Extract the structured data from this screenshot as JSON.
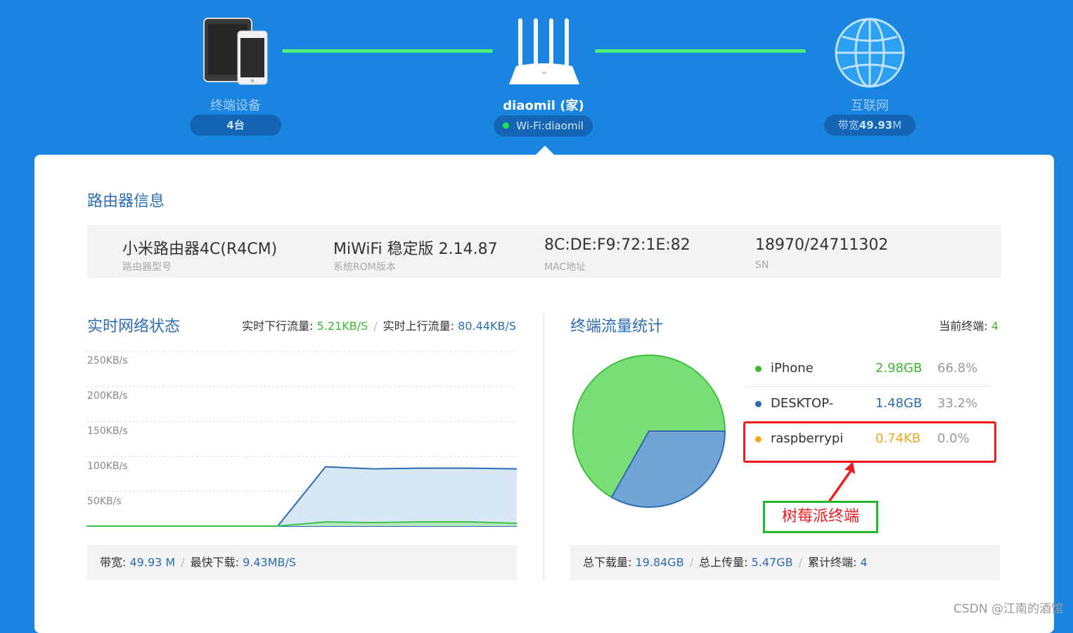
{
  "topology": {
    "devices": {
      "label": "终端设备",
      "count": "4台"
    },
    "router": {
      "name": "diaomil (家)",
      "wifi": "Wi-Fi:diaomil"
    },
    "internet": {
      "label": "互联网",
      "bandwidth_prefix": "带宽",
      "bandwidth_value": "49.93",
      "bandwidth_unit": "M"
    }
  },
  "router_info": {
    "title": "路由器信息",
    "items": [
      {
        "value": "小米路由器4C(R4CM)",
        "label": "路由器型号"
      },
      {
        "value": "MiWiFi 稳定版 2.14.87",
        "label": "系统ROM版本"
      },
      {
        "value": "8C:DE:F9:72:1E:82",
        "label": "MAC地址"
      },
      {
        "value": "18970/24711302",
        "label": "SN"
      }
    ]
  },
  "network_status": {
    "title": "实时网络状态",
    "down_label": "实时下行流量:",
    "down_value": "5.21KB/S",
    "up_label": "实时上行流量:",
    "up_value": "80.44KB/S",
    "bandwidth_label": "带宽:",
    "bandwidth_value": "49.93 M",
    "max_down_label": "最快下载:",
    "max_down_value": "9.43MB/S"
  },
  "chart_data": [
    {
      "type": "area",
      "y_tick_labels": [
        "250KB/s",
        "200KB/s",
        "150KB/s",
        "100KB/s",
        "50KB/s"
      ],
      "ylim": [
        0,
        250
      ],
      "x": [
        0,
        1,
        2,
        3,
        4,
        5,
        6,
        7,
        8,
        9
      ],
      "series": [
        {
          "values": [
            0,
            0,
            0,
            0,
            0,
            0,
            0,
            0,
            0,
            0
          ]
        },
        {
          "values": [
            0,
            0,
            0,
            0,
            0,
            85,
            82,
            83,
            83,
            82
          ]
        },
        {
          "values": [
            0,
            0,
            0,
            0,
            0,
            6,
            5,
            6,
            6,
            4
          ]
        }
      ],
      "colors": {
        "line_blue": "#2a6db4",
        "fill_blue": "#d4e4f4",
        "line_green": "#3cc24a",
        "fill_green": "#b9e4bd"
      },
      "grid": true
    },
    {
      "type": "pie",
      "labels": [
        "iPhone",
        "DESKTOP-",
        "raspberrypi"
      ],
      "values": [
        66.8,
        33.2,
        0.0
      ],
      "colors": [
        "#7ade76",
        "#72a5d6",
        "#f5a623"
      ]
    }
  ],
  "traffic_stats": {
    "title": "终端流量统计",
    "current_label": "当前终端:",
    "current_value": "4",
    "devices": [
      {
        "name": "iPhone",
        "size": "2.98GB",
        "pct": "66.8%"
      },
      {
        "name": "DESKTOP-",
        "size": "1.48GB",
        "pct": "33.2%"
      },
      {
        "name": "raspberrypi",
        "size": "0.74KB",
        "pct": "0.0%"
      }
    ],
    "total_down_label": "总下载量:",
    "total_down_value": "19.84GB",
    "total_up_label": "总上传量:",
    "total_up_value": "5.47GB",
    "cumulative_label": "累计终端:",
    "cumulative_value": "4"
  },
  "annotation": {
    "text": "树莓派终端"
  },
  "watermark": "CSDN @江南的酒馆",
  "colors": {
    "page_bg": "#1a85e0",
    "link_line": "#4ef07a",
    "accent_blue": "#2a6db4",
    "accent_green": "#3bb82e",
    "highlight_red": "#ee1c1c",
    "callout_green": "#22b82a"
  }
}
